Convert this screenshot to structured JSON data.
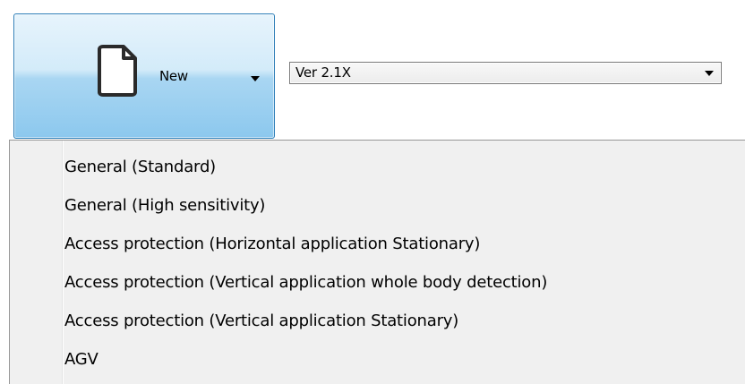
{
  "toolbar": {
    "new_button": {
      "label": "New",
      "icon": "document-icon",
      "caret_icon": "dropdown-caret-icon"
    },
    "version_select": {
      "selected": "Ver 2.1X",
      "caret_icon": "dropdown-caret-icon"
    }
  },
  "menu": {
    "items": [
      {
        "label": "General (Standard)"
      },
      {
        "label": "General (High sensitivity)"
      },
      {
        "label": "Access protection (Horizontal application Stationary)"
      },
      {
        "label": "Access protection (Vertical application whole body detection)"
      },
      {
        "label": "Access protection (Vertical application Stationary)"
      },
      {
        "label": "AGV"
      }
    ]
  },
  "colors": {
    "button_top": "#e7f4fc",
    "button_bottom": "#8cc8ee",
    "button_border": "#2f7fb8",
    "menu_background": "#f0f0f0"
  }
}
